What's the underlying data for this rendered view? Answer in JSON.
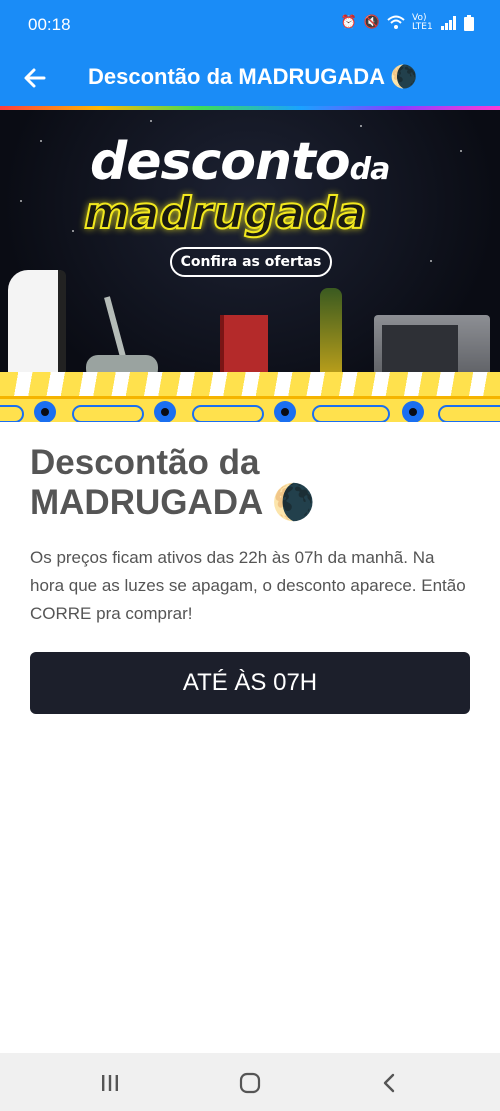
{
  "status_bar": {
    "time": "00:18",
    "icons": [
      "alarm-icon",
      "mute-icon",
      "wifi-icon",
      "volte-icon",
      "signal-icon",
      "battery-icon"
    ],
    "volte_label": "Vo) LTE1"
  },
  "app_bar": {
    "title": "Descontão da MADRUGADA 🌘"
  },
  "banner": {
    "title_line1": "desconto",
    "title_line1_suffix": "da",
    "title_line2": "madrugada",
    "cta_label": "Confira as ofertas"
  },
  "content": {
    "title": "Descontão da MADRUGADA 🌘",
    "description": "Os preços ficam ativos das 22h às 07h da manhã. Na hora que as luzes se apagam, o desconto aparece. Então CORRE pra comprar!",
    "button_label": "ATÉ ÀS 07H"
  },
  "nav": {
    "icons": [
      "recent-apps-icon",
      "home-icon",
      "back-nav-icon"
    ]
  },
  "colors": {
    "primary": "#1a8cf7",
    "button_dark": "#1c1f2b",
    "neon_yellow": "#f2e81e",
    "conveyor_yellow": "#ffe14d",
    "conveyor_blue": "#1a6ff0"
  }
}
